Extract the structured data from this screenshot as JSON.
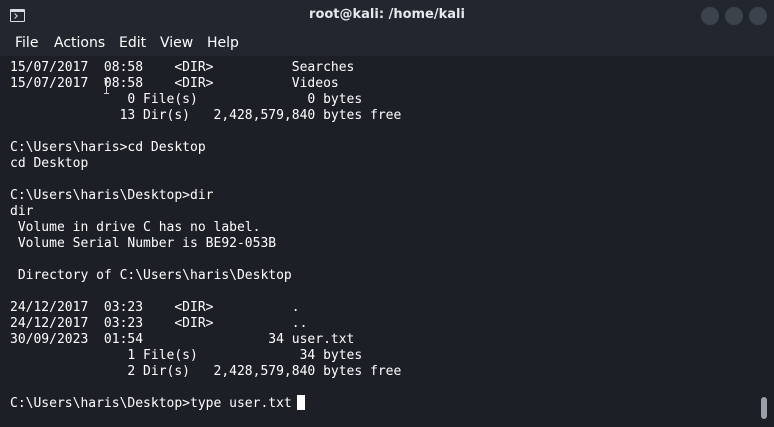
{
  "window": {
    "title": "root@kali: /home/kali",
    "icons": [
      "terminal-icon",
      "minimize-icon",
      "maximize-icon",
      "close-icon"
    ]
  },
  "menu": {
    "file": "File",
    "actions": "Actions",
    "edit": "Edit",
    "view": "View",
    "help": "Help"
  },
  "terminal": {
    "lines": [
      "15/07/2017  08:58    <DIR>          Searches",
      "15/07/2017  08:58    <DIR>          Videos",
      "               0 File(s)              0 bytes",
      "              13 Dir(s)   2,428,579,840 bytes free",
      "",
      "C:\\Users\\haris>cd Desktop",
      "cd Desktop",
      "",
      "C:\\Users\\haris\\Desktop>dir",
      "dir",
      " Volume in drive C has no label.",
      " Volume Serial Number is BE92-053B",
      "",
      " Directory of C:\\Users\\haris\\Desktop",
      "",
      "24/12/2017  03:23    <DIR>          .",
      "24/12/2017  03:23    <DIR>          ..",
      "30/09/2023  01:54                34 user.txt",
      "               1 File(s)             34 bytes",
      "               2 Dir(s)   2,428,579,840 bytes free",
      "",
      "C:\\Users\\haris\\Desktop>type user.txt"
    ]
  },
  "colors": {
    "background": "#1c1f26",
    "chrome": "#22262e",
    "text": "#ffffff",
    "window_button": "#3d434d"
  }
}
